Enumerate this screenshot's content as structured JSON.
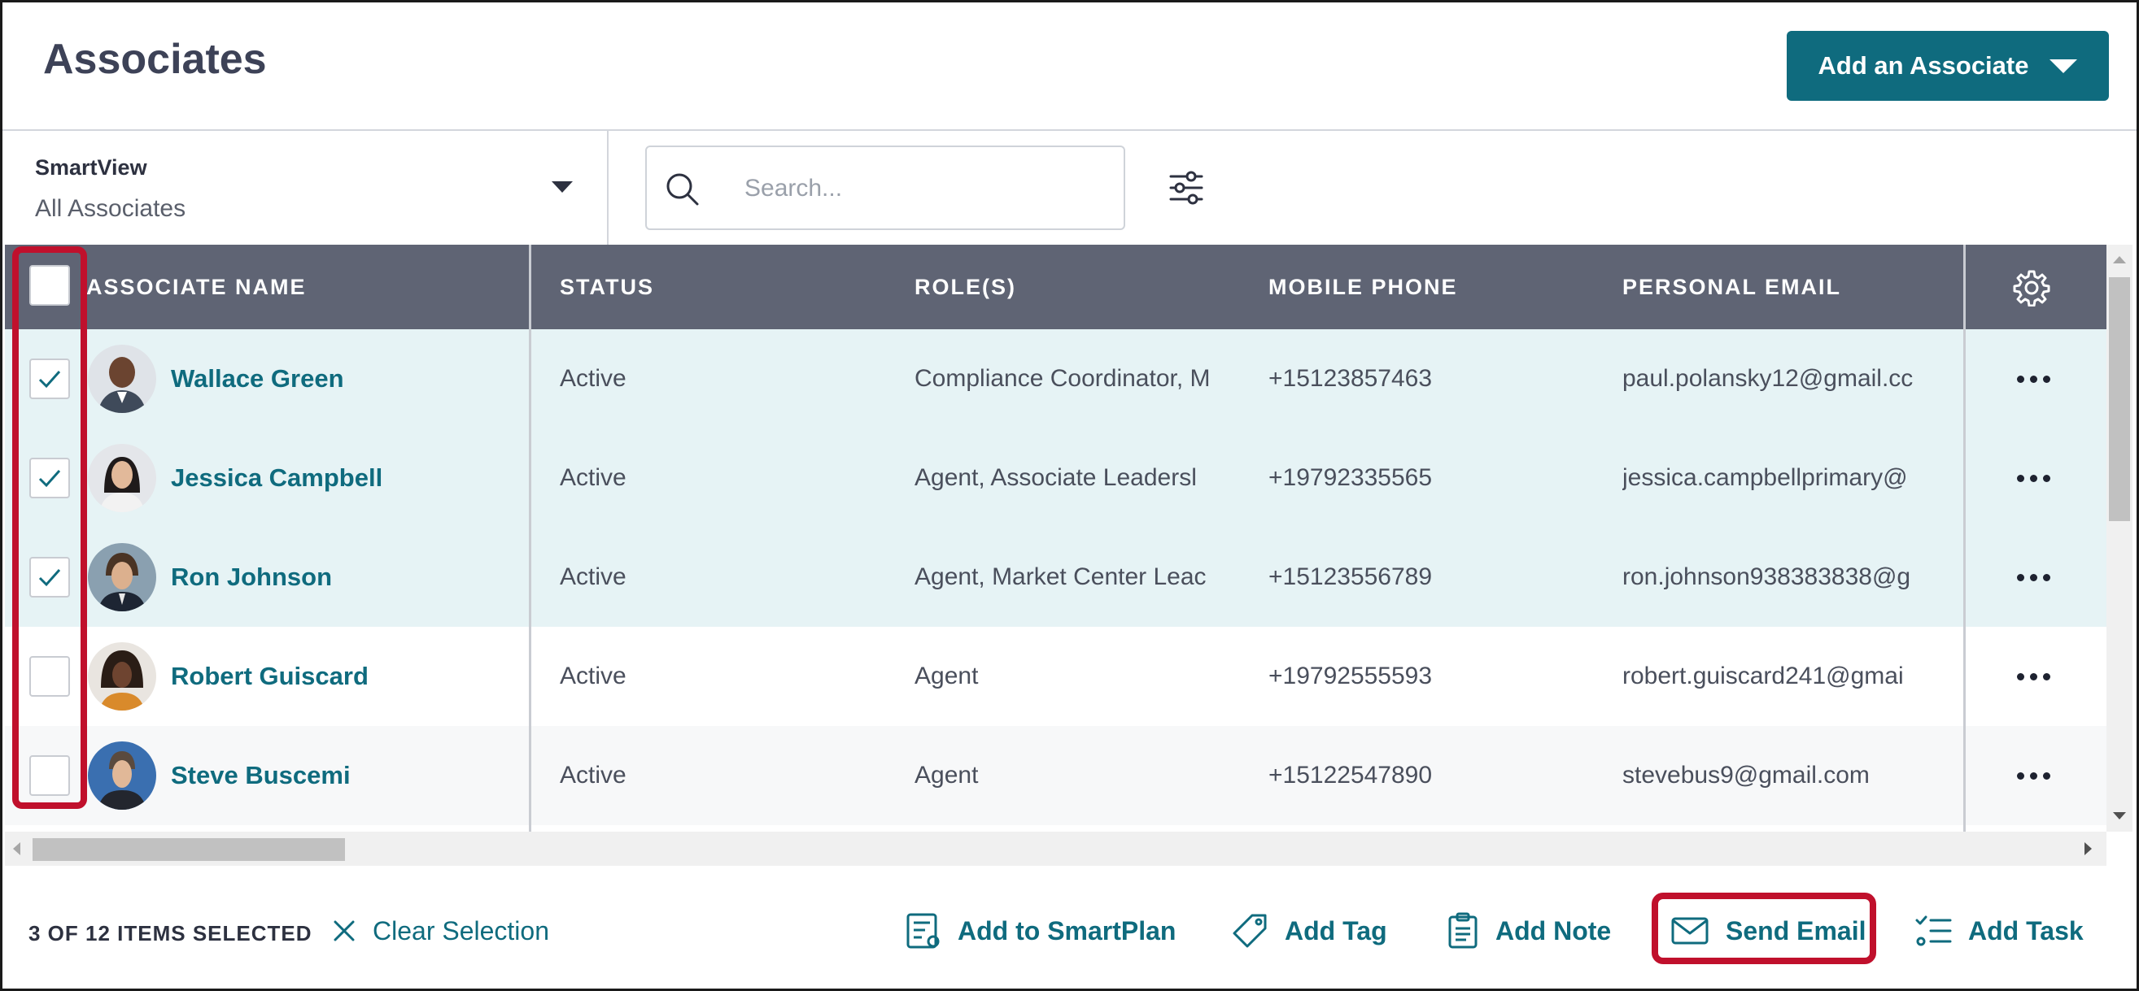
{
  "header": {
    "title": "Associates",
    "add_button_label": "Add an Associate"
  },
  "toolbar": {
    "smartview_label": "SmartView",
    "smartview_value": "All Associates",
    "search_placeholder": "Search..."
  },
  "table": {
    "columns": [
      "ASSOCIATE NAME",
      "STATUS",
      "ROLE(S)",
      "MOBILE PHONE",
      "PERSONAL EMAIL"
    ],
    "rows": [
      {
        "name": "Wallace Green",
        "status": "Active",
        "roles": "Compliance Coordinator, M",
        "phone": "+15123857463",
        "email": "paul.polansky12@gmail.cc",
        "selected": true
      },
      {
        "name": "Jessica Campbell",
        "status": "Active",
        "roles": "Agent, Associate Leadersl",
        "phone": "+19792335565",
        "email": "jessica.campbellprimary@",
        "selected": true
      },
      {
        "name": "Ron Johnson",
        "status": "Active",
        "roles": "Agent, Market Center Leac",
        "phone": "+15123556789",
        "email": "ron.johnson938383838@g",
        "selected": true
      },
      {
        "name": "Robert Guiscard",
        "status": "Active",
        "roles": "Agent",
        "phone": "+19792555593",
        "email": "robert.guiscard241@gmai",
        "selected": false
      },
      {
        "name": "Steve Buscemi",
        "status": "Active",
        "roles": "Agent",
        "phone": "+15122547890",
        "email": "stevebus9@gmail.com",
        "selected": false
      }
    ]
  },
  "actionbar": {
    "selection_count": "3 OF 12 ITEMS SELECTED",
    "clear_selection": "Clear Selection",
    "add_to_smartplan": "Add to SmartPlan",
    "add_tag": "Add Tag",
    "add_note": "Add Note",
    "send_email": "Send Email",
    "add_task": "Add Task"
  },
  "colors": {
    "brand": "#0f6b7e",
    "header_bg": "#5f6474",
    "selected_row": "#e6f3f5",
    "highlight": "#c0102c"
  },
  "icons": [
    "search-icon",
    "filter-icon",
    "gear-icon",
    "check-icon",
    "more-icon",
    "close-icon",
    "smartplan-icon",
    "tag-icon",
    "clipboard-icon",
    "envelope-icon",
    "task-list-icon",
    "chevron-down-icon"
  ]
}
